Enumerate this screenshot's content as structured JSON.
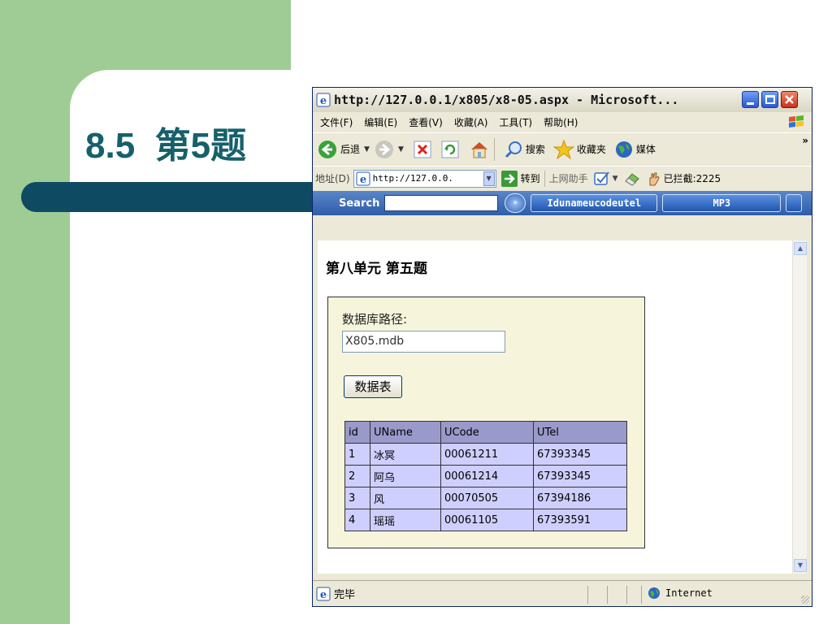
{
  "slide": {
    "title_num": "8.5",
    "title_text": "第5题"
  },
  "window": {
    "title": "http://127.0.0.1/x805/x8-05.aspx - Microsoft...",
    "menu": [
      {
        "label": "文件(F)"
      },
      {
        "label": "编辑(E)"
      },
      {
        "label": "查看(V)"
      },
      {
        "label": "收藏(A)"
      },
      {
        "label": "工具(T)"
      },
      {
        "label": "帮助(H)"
      }
    ],
    "toolbar": {
      "back": "后退",
      "search": "搜索",
      "favorites": "收藏夹",
      "media": "媒体",
      "more": "»"
    },
    "address": {
      "label": "地址(D)",
      "value": "http://127.0.0.",
      "go": "转到",
      "assistant": "上网助手",
      "blocked": "已拦截:2225"
    },
    "searchbar": {
      "label": "Search",
      "pill1": "Idunameucodeutel",
      "pill2": "MP3"
    },
    "statusbar": {
      "status": "完毕",
      "zone": "Internet"
    }
  },
  "page": {
    "heading": "第八单元 第五题",
    "db_label": "数据库路径:",
    "db_value": "X805.mdb",
    "button": "数据表",
    "table": {
      "headers": [
        "id",
        "UName",
        "UCode",
        "UTel"
      ],
      "rows": [
        [
          "1",
          "冰冥",
          "00061211",
          "67393345"
        ],
        [
          "2",
          "阿乌",
          "00061214",
          "67393345"
        ],
        [
          "3",
          "风",
          "00070505",
          "67394186"
        ],
        [
          "4",
          "瑶瑶",
          "00061105",
          "67393591"
        ]
      ]
    }
  },
  "colors": {
    "accent_green": "#9fcc94",
    "title_teal": "#16606b",
    "bar_navy": "#0f4a63",
    "panel_bg": "#f6f5dc",
    "table_header": "#9999cc",
    "table_cell": "#cfcfff"
  }
}
